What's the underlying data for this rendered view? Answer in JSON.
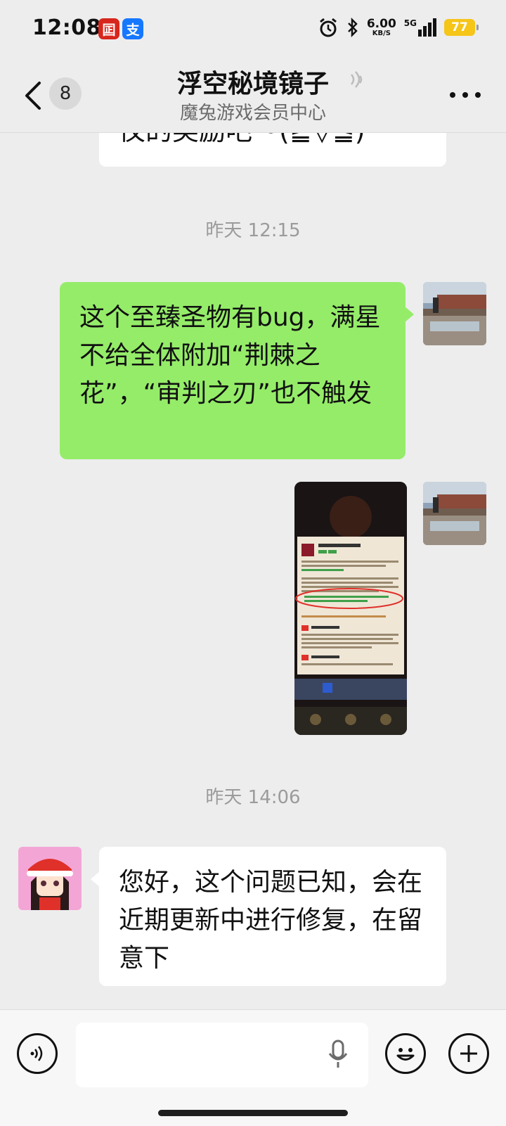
{
  "status_bar": {
    "time": "12:08",
    "apps": [
      {
        "name": "bank-of-china",
        "glyph": "囸",
        "color": "#d7261c"
      },
      {
        "name": "alipay",
        "glyph": "支",
        "color": "#1677ff"
      }
    ],
    "net_speed_value": "6.00",
    "net_speed_unit": "KB/S",
    "network": "5G",
    "battery": "77"
  },
  "header": {
    "unread_count": "8",
    "title": "浮空秘境镜子",
    "subtitle": "魔兔游戏会员中心"
  },
  "messages": {
    "partial_top": "仪的奖励吧～(≧▽≦)",
    "timestamp_1": "昨天 12:15",
    "user_msg": "这个至臻圣物有bug，满星不给全体附加“荆棘之花”，“审判之刃”也不触发",
    "timestamp_2": "昨天 14:06",
    "reply_msg": "您好，这个问题已知，会在近期更新中进行修复，在留意下"
  },
  "screenshot_attachment": {
    "card_title": "圣十字玫瑰",
    "tags": [
      "神器",
      "物攻"
    ],
    "link_1": "【荆棘之花】",
    "link_2": "【审判之刃】",
    "skill_1": "漫天花雨！",
    "skill_2": "赎罪！",
    "colors": {
      "accent_green": "#3fa04a",
      "highlight_red": "#e0302a"
    }
  },
  "input_bar": {
    "placeholder": ""
  }
}
